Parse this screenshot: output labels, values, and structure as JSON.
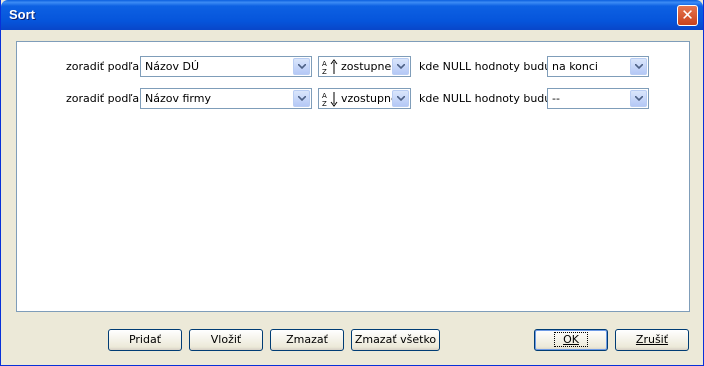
{
  "window": {
    "title": "Sort",
    "close_glyph": "✕"
  },
  "rows": [
    {
      "label": "zoradiť podľa",
      "field": "Názov DÚ",
      "direction": "zostupne",
      "direction_icon": "sort-descending-icon",
      "null_label": "kde NULL hodnoty budú",
      "null_value": "na konci"
    },
    {
      "label": "zoradiť podľa",
      "field": "Názov firmy",
      "direction": "vzostupne",
      "direction_icon": "sort-ascending-icon",
      "null_label": "kde NULL hodnoty budú",
      "null_value": "--"
    }
  ],
  "buttons": {
    "add": "Pridať",
    "insert": "Vložiť",
    "delete": "Zmazať",
    "delete_all": "Zmazať všetko",
    "ok": "OK",
    "cancel": "Zrušiť"
  },
  "colors": {
    "titlebar": "#0655db",
    "panel_border": "#7f9db9",
    "dialog_bg": "#ece9d8"
  }
}
